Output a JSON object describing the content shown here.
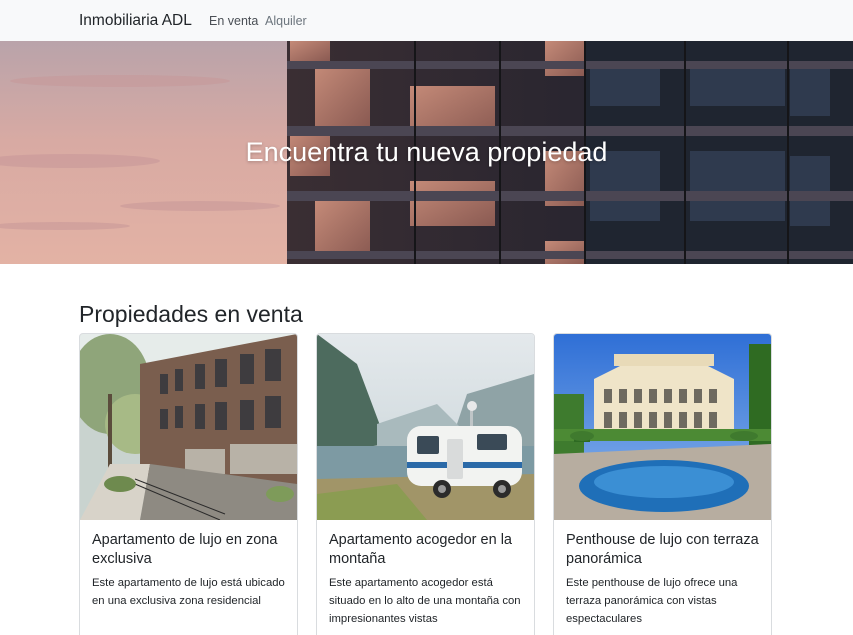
{
  "navbar": {
    "brand": "Inmobiliaria ADL",
    "links": [
      {
        "label": "En venta"
      },
      {
        "label": "Alquiler"
      }
    ]
  },
  "hero": {
    "title": "Encuentra tu nueva propiedad"
  },
  "section": {
    "title": "Propiedades en venta"
  },
  "cards": [
    {
      "title": "Apartamento de lujo en zona exclusiva",
      "text": "Este apartamento de lujo está ubicado en una exclusiva zona residencial"
    },
    {
      "title": "Apartamento acogedor en la montaña",
      "text": "Este apartamento acogedor está situado en lo alto de una montaña con impresionantes vistas"
    },
    {
      "title": "Penthouse de lujo con terraza panorámica",
      "text": "Este penthouse de lujo ofrece una terraza panorámica con vistas espectaculares"
    }
  ],
  "colors": {
    "navbar_bg": "#f8f9fa",
    "text": "#212529",
    "muted_link": "#6c757d"
  }
}
